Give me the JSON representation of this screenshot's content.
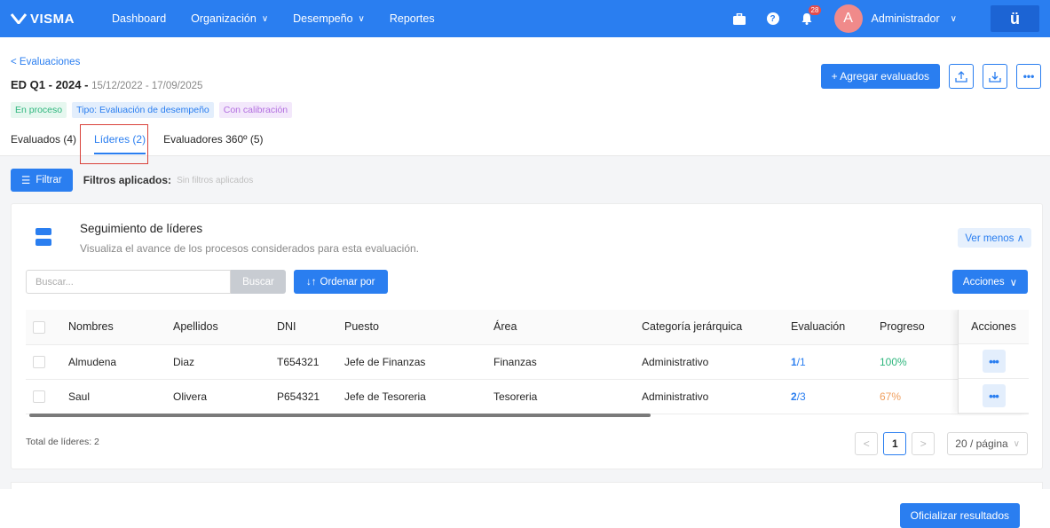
{
  "nav": {
    "logo": "VISMA",
    "items": [
      {
        "label": "Dashboard",
        "dropdown": false
      },
      {
        "label": "Organización",
        "dropdown": true
      },
      {
        "label": "Desempeño",
        "dropdown": true
      },
      {
        "label": "Reportes",
        "dropdown": false
      }
    ],
    "notification_count": "28",
    "avatar_initial": "A",
    "user_name": "Administrador",
    "app_icon": "ü"
  },
  "header": {
    "back_link": "< Evaluaciones",
    "title": "ED Q1 - 2024 -",
    "dates": "15/12/2022 - 17/09/2025",
    "tags": [
      "En proceso",
      "Tipo: Evaluación de desempeño",
      "Con calibración"
    ],
    "tabs": [
      "Evaluados (4)",
      "Líderes (2)",
      "Evaluadores 360º (5)"
    ],
    "active_tab": "Líderes (2)",
    "add_button": "+ Agregar evaluados",
    "more_icon": "•••"
  },
  "filters": {
    "button": "Filtrar",
    "label": "Filtros aplicados:",
    "value": "Sin filtros aplicados"
  },
  "card": {
    "title": "Seguimiento de líderes",
    "subtitle": "Visualiza el avance de los procesos considerados para esta evaluación.",
    "toggle": "Ver menos",
    "search_placeholder": "Buscar...",
    "search_button": "Buscar",
    "sort_button": "Ordenar por",
    "actions_button": "Acciones"
  },
  "table": {
    "columns": [
      "Nombres",
      "Apellidos",
      "DNI",
      "Puesto",
      "Área",
      "Categoría jerárquica",
      "Evaluación",
      "Progreso",
      "Acciones"
    ],
    "rows": [
      {
        "nombres": "Almudena",
        "apellidos": "Diaz",
        "dni": "T654321",
        "puesto": "Jefe de Finanzas",
        "area": "Finanzas",
        "categoria": "Administrativo",
        "eval_done": "1",
        "eval_total": "/1",
        "progreso": "100%"
      },
      {
        "nombres": "Saul",
        "apellidos": "Olivera",
        "dni": "P654321",
        "puesto": "Jefe de Tesoreria",
        "area": "Tesoreria",
        "categoria": "Administrativo",
        "eval_done": "2",
        "eval_total": "/3",
        "progreso": "67%"
      }
    ],
    "row_action_icon": "•••"
  },
  "footer": {
    "total": "Total de líderes: 2",
    "current_page": "1",
    "page_size": "20 / página",
    "official_button": "Oficializar resultados"
  },
  "colors": {
    "primary": "#2a7ef0",
    "success": "#2eb67d",
    "warning": "#f0a060",
    "highlight": "#d9423a"
  }
}
